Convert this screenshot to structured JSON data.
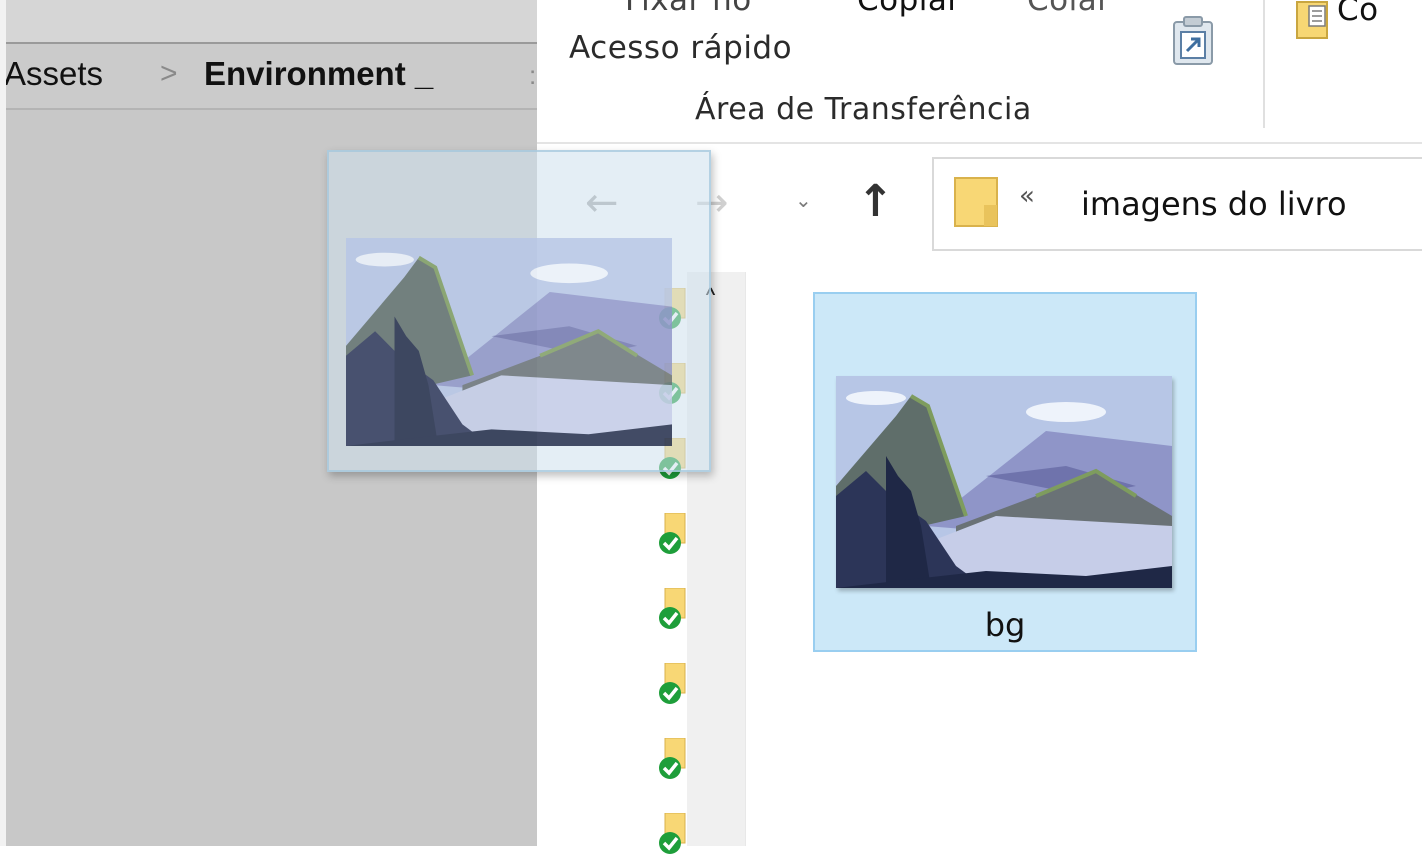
{
  "editor": {
    "breadcrumb": [
      "Assets",
      ">",
      "Environment _",
      ":"
    ]
  },
  "explorer": {
    "ribbon": {
      "pin_label_top": "Fixar no",
      "pin_label_bottom": "Acesso rápido",
      "copy_label": "Copiar",
      "paste_label": "Colar",
      "group_label": "Área de Transferência",
      "next_group_label": "Co"
    },
    "nav": {
      "back_icon": "arrow-left-icon",
      "forward_icon": "arrow-right-icon",
      "recent_icon": "chevron-down-icon",
      "up_icon": "arrow-up-icon",
      "address_chevron": "«",
      "address_path": "imagens do livro"
    },
    "files": [
      {
        "name": "bg",
        "selected": true
      }
    ],
    "nav_pane_item_count": 8
  },
  "drag": {
    "file_name": "bg",
    "icon": "image-thumbnail-icon"
  },
  "colors": {
    "selection_fill": "#cce8f8",
    "selection_border": "#99cef0",
    "folder_yellow": "#f8d775",
    "sync_green": "#1e9e3a"
  }
}
